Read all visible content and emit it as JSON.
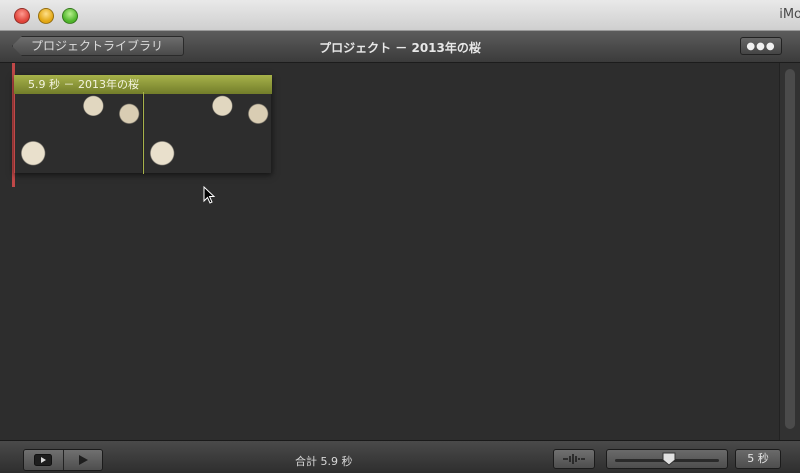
{
  "window": {
    "app_title": "iMo"
  },
  "header": {
    "back_label": "プロジェクトライブラリ",
    "title": "プロジェクト － 2013年の桜",
    "more_icon": "ellipsis-icon"
  },
  "clip": {
    "label": "5.9 秒 － 2013年の桜"
  },
  "footer": {
    "total": "合計 5.9 秒",
    "zoom_value": "5 秒",
    "zoom_level": 0.52
  },
  "colors": {
    "clip_bar": "#a7b24a",
    "playhead": "#c04848",
    "background": "#2d2d2d"
  }
}
